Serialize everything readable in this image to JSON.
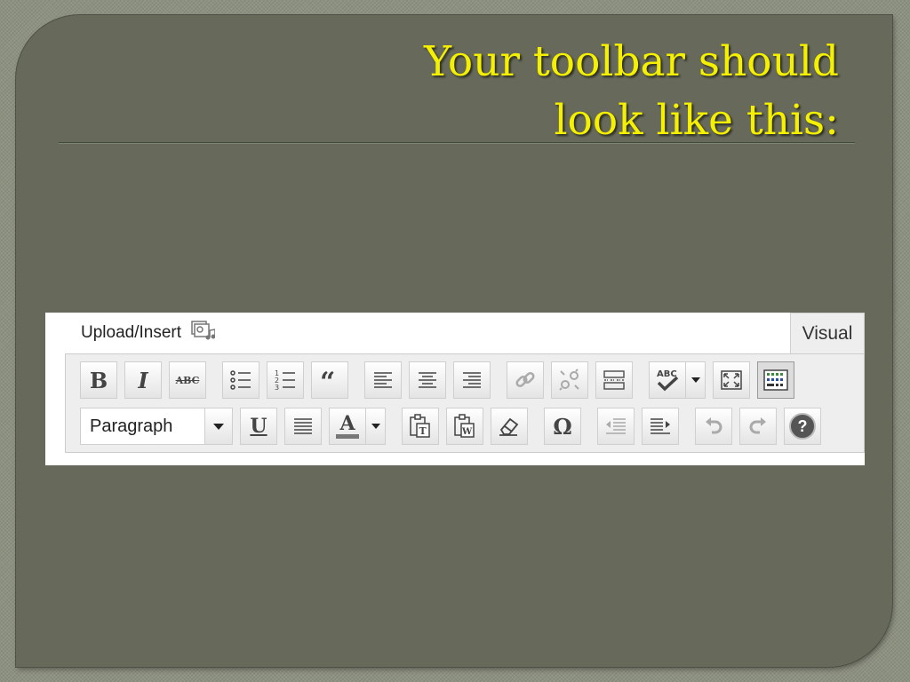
{
  "slide": {
    "title_line1": "Your toolbar should",
    "title_line2": "look like this:"
  },
  "editor": {
    "upload_label": "Upload/Insert",
    "tab_visual": "Visual",
    "format_select_value": "Paragraph",
    "bold_glyph": "B",
    "italic_glyph": "I",
    "strike_glyph": "ABC",
    "underline_glyph": "U",
    "color_glyph": "A",
    "special_char_glyph": "Ω",
    "spell_glyph": "ABC",
    "help_glyph": "?"
  },
  "colors": {
    "slide_bg": "#676a5a",
    "title": "#f4f000",
    "toolbar_bg": "#eeeeee"
  }
}
